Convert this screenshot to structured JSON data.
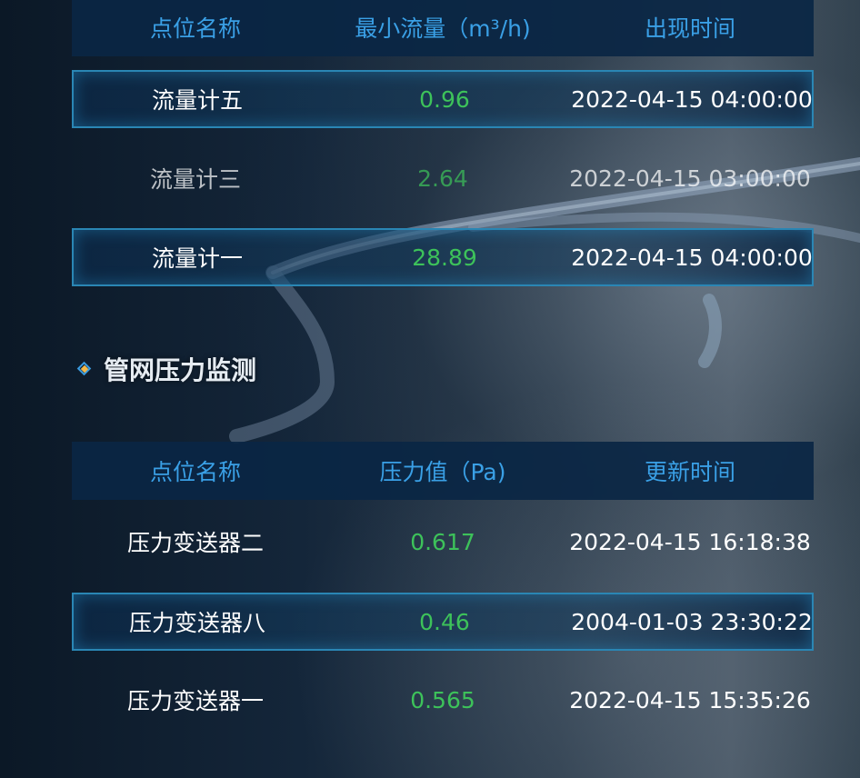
{
  "flow_table": {
    "headers": [
      "点位名称",
      "最小流量（m³/h)",
      "出现时间"
    ],
    "rows": [
      {
        "name": "流量计五",
        "value": "0.96",
        "time": "2022-04-15 04:00:00"
      },
      {
        "name": "流量计三",
        "value": "2.64",
        "time": "2022-04-15 03:00:00"
      },
      {
        "name": "流量计一",
        "value": "28.89",
        "time": "2022-04-15 04:00:00"
      }
    ]
  },
  "pressure_section": {
    "title": "管网压力监测",
    "icon": "diamond-icon"
  },
  "pressure_table": {
    "headers": [
      "点位名称",
      "压力值（Pa)",
      "更新时间"
    ],
    "rows": [
      {
        "name": "压力变送器二",
        "value": "0.617",
        "time": "2022-04-15 16:18:38"
      },
      {
        "name": "压力变送器八",
        "value": "0.46",
        "time": "2004-01-03 23:30:22"
      },
      {
        "name": "压力变送器一",
        "value": "0.565",
        "time": "2022-04-15 15:35:26"
      }
    ]
  },
  "colors": {
    "header_text": "#3aa0e6",
    "value_text": "#3dc25a",
    "highlight_border": "#2a86b4",
    "header_bg": "#0a2644"
  }
}
